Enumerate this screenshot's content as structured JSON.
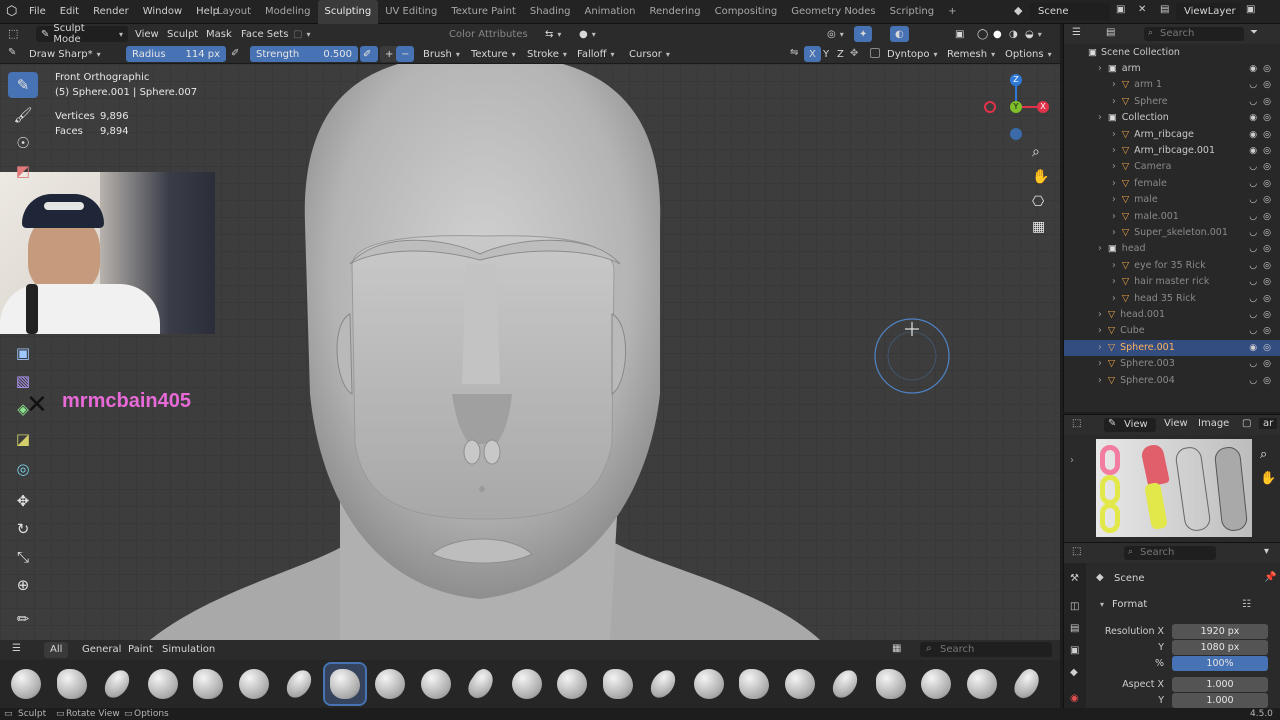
{
  "topbar": {
    "menus": [
      "File",
      "Edit",
      "Render",
      "Window",
      "Help"
    ],
    "workspaces": [
      "Layout",
      "Modeling",
      "Sculpting",
      "UV Editing",
      "Texture Paint",
      "Shading",
      "Animation",
      "Rendering",
      "Compositing",
      "Geometry Nodes",
      "Scripting"
    ],
    "active_workspace": "Sculpting",
    "add_tab": "+",
    "scene_label": "Scene",
    "view_layer_label": "ViewLayer"
  },
  "viewport_header": {
    "mode": "Sculpt Mode",
    "menus": [
      "View",
      "Sculpt",
      "Mask",
      "Face Sets"
    ],
    "color_attributes": "Color Attributes"
  },
  "tool_header": {
    "brush_name": "Draw Sharp*",
    "radius_label": "Radius",
    "radius_value": "114 px",
    "strength_label": "Strength",
    "strength_value": "0.500",
    "plus": "+",
    "minus": "−",
    "dropdowns": [
      "Brush",
      "Texture",
      "Stroke",
      "Falloff",
      "Cursor"
    ],
    "axes": [
      "X",
      "Y",
      "Z"
    ],
    "dyntopo": "Dyntopo",
    "remesh": "Remesh",
    "options": "Options"
  },
  "overlay": {
    "view_name": "Front Orthographic",
    "object_info": "(5) Sphere.001 | Sphere.007",
    "vertices_label": "Vertices",
    "vertices_value": "9,896",
    "faces_label": "Faces",
    "faces_value": "9,894",
    "watermark": "mrmcbain405"
  },
  "gizmo": {
    "z": "Z",
    "y": "Y",
    "x": "X"
  },
  "outliner": {
    "search_placeholder": "Search",
    "root": "Scene Collection",
    "rows": [
      {
        "label": "arm",
        "indent": 1,
        "dim": false,
        "sel": false
      },
      {
        "label": "arm 1",
        "indent": 2,
        "dim": true,
        "sel": false
      },
      {
        "label": "Sphere",
        "indent": 2,
        "dim": true,
        "sel": false
      },
      {
        "label": "Collection",
        "indent": 1,
        "dim": false,
        "sel": false
      },
      {
        "label": "Arm_ribcage",
        "indent": 2,
        "dim": false,
        "sel": false
      },
      {
        "label": "Arm_ribcage.001",
        "indent": 2,
        "dim": false,
        "sel": false
      },
      {
        "label": "Camera",
        "indent": 2,
        "dim": true,
        "sel": false
      },
      {
        "label": "female",
        "indent": 2,
        "dim": true,
        "sel": false
      },
      {
        "label": "male",
        "indent": 2,
        "dim": true,
        "sel": false
      },
      {
        "label": "male.001",
        "indent": 2,
        "dim": true,
        "sel": false
      },
      {
        "label": "Super_skeleton.001",
        "indent": 2,
        "dim": true,
        "sel": false
      },
      {
        "label": "head",
        "indent": 1,
        "dim": true,
        "sel": false
      },
      {
        "label": "eye for 35 Rick",
        "indent": 2,
        "dim": true,
        "sel": false
      },
      {
        "label": "hair master rick",
        "indent": 2,
        "dim": true,
        "sel": false
      },
      {
        "label": "head 35 Rick",
        "indent": 2,
        "dim": true,
        "sel": false
      },
      {
        "label": "head.001",
        "indent": 1,
        "dim": true,
        "sel": false
      },
      {
        "label": "Cube",
        "indent": 1,
        "dim": true,
        "sel": false
      },
      {
        "label": "Sphere.001",
        "indent": 1,
        "dim": false,
        "sel": true
      },
      {
        "label": "Sphere.003",
        "indent": 1,
        "dim": true,
        "sel": false
      },
      {
        "label": "Sphere.004",
        "indent": 1,
        "dim": true,
        "sel": false
      }
    ]
  },
  "image_editor": {
    "menus": [
      "View",
      "View",
      "Image"
    ],
    "extra": "ar"
  },
  "properties": {
    "search_placeholder": "Search",
    "scene": "Scene",
    "section": "Format",
    "res_x_label": "Resolution X",
    "res_x": "1920 px",
    "res_y_label": "Y",
    "res_y": "1080 px",
    "pct_label": "%",
    "pct": "100%",
    "aspect_x_label": "Aspect X",
    "aspect_x": "1.000",
    "aspect_y_label": "Y",
    "aspect_y": "1.000"
  },
  "shelf": {
    "tabs": [
      "All",
      "General",
      "Paint",
      "Simulation"
    ],
    "active_tab": "All",
    "search_placeholder": "Search"
  },
  "statusbar": {
    "left1": "Sculpt",
    "left2": "Rotate View",
    "left3": "Options",
    "version": "4.5.0"
  },
  "colors": {
    "accent": "#4772b3",
    "selected_text": "#ffb35c",
    "watermark": "#e86ad8"
  }
}
